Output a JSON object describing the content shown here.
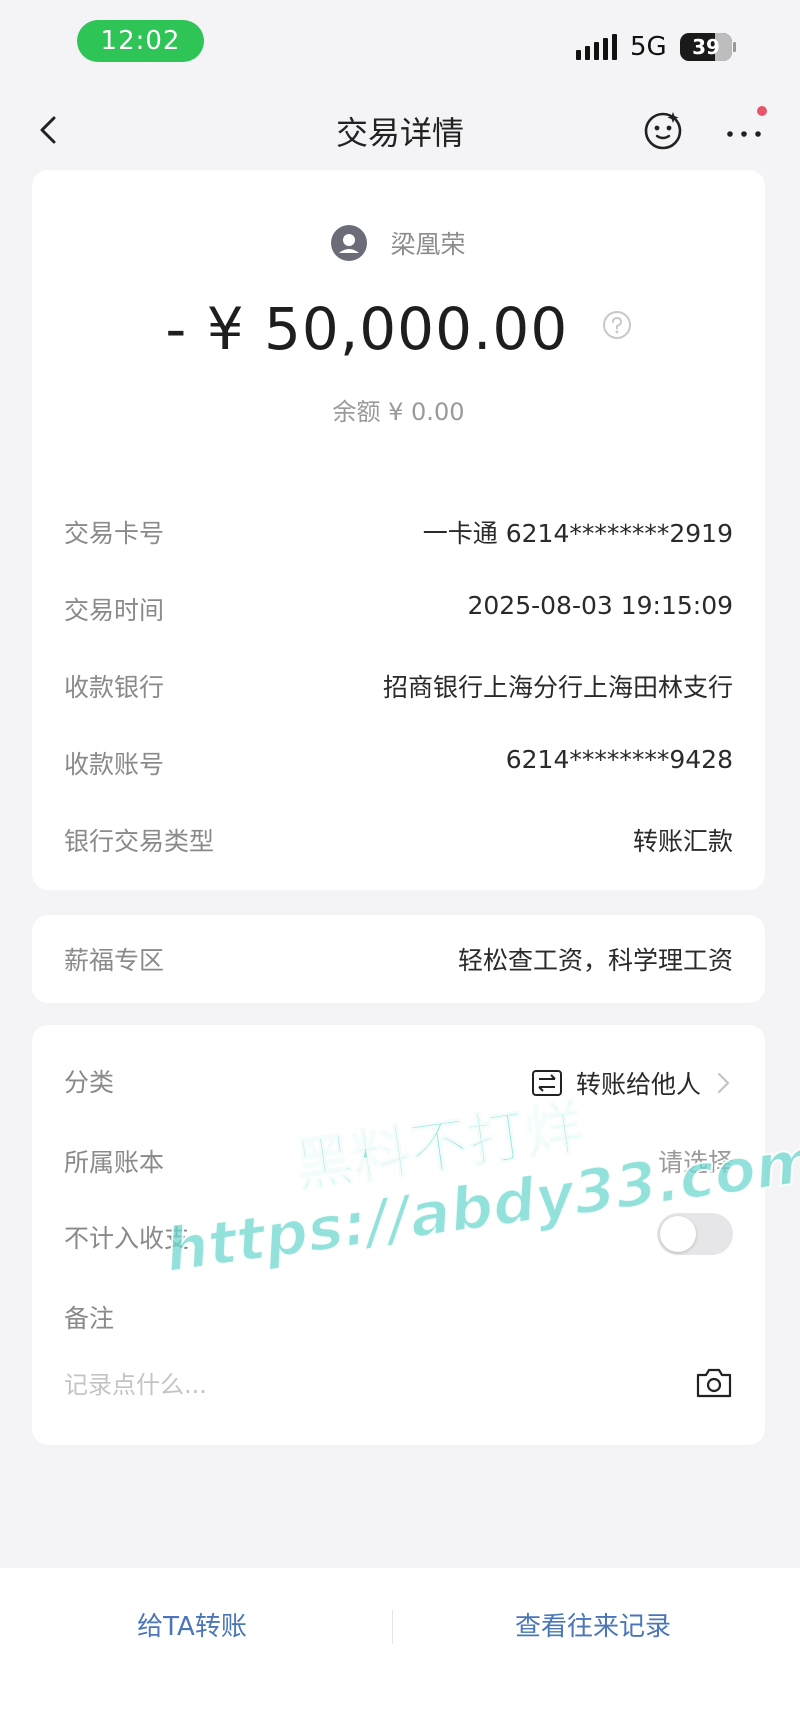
{
  "status_bar": {
    "time": "12:02",
    "network": "5G",
    "battery": "39",
    "icons": [
      "signal-icon",
      "battery-icon"
    ]
  },
  "nav": {
    "title": "交易详情",
    "icons": [
      "back-icon",
      "robot-assistant-icon",
      "more-icon"
    ]
  },
  "transaction": {
    "payee": "梁凰荣",
    "amount": "- ¥ 50,000.00",
    "balance": "余额 ¥ 0.00",
    "details": [
      {
        "label": "交易卡号",
        "value": "一卡通 6214********2919"
      },
      {
        "label": "交易时间",
        "value": "2025-08-03 19:15:09"
      },
      {
        "label": "收款银行",
        "value": "招商银行上海分行上海田林支行"
      },
      {
        "label": "收款账号",
        "value": "6214********9428"
      },
      {
        "label": "银行交易类型",
        "value": "转账汇款"
      }
    ]
  },
  "salary": {
    "label": "薪福专区",
    "value": "轻松查工资，科学理工资"
  },
  "extra": {
    "category_label": "分类",
    "category_value": "转账给他人",
    "ledger_label": "所属账本",
    "ledger_value": "请选择",
    "exclude_label": "不计入收支",
    "exclude_on": false,
    "memo_label": "备注",
    "memo_placeholder": "记录点什么..."
  },
  "bottom": {
    "transfer_label": "给TA转账",
    "history_label": "查看往来记录"
  },
  "watermark": {
    "line1": "黑料不打烊",
    "line2": "https://abdy33.com"
  },
  "colors": {
    "time_pill": "#2ec556",
    "link": "#4a76b8",
    "notification_dot": "#e8556a"
  }
}
